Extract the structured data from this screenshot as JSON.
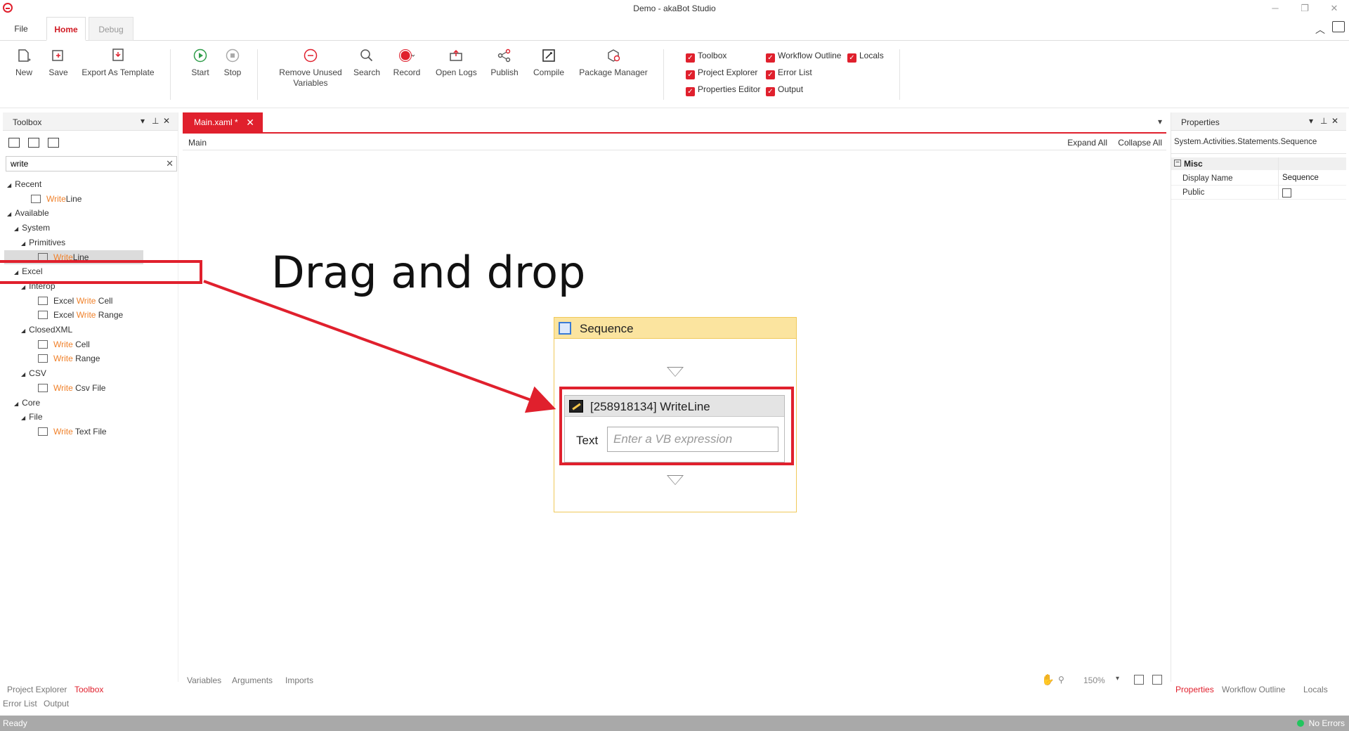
{
  "window": {
    "title": "Demo - akaBot Studio",
    "minimize": "─",
    "restore": "❐",
    "close": "✕"
  },
  "ribbon_tabs": [
    "File",
    "Home",
    "Debug"
  ],
  "ribbon": {
    "buttons": [
      {
        "label": "New",
        "icon": "new-file-icon"
      },
      {
        "label": "Save",
        "icon": "save-icon"
      },
      {
        "label": "Export As Template",
        "icon": "export-template-icon"
      },
      {
        "label": "Start",
        "icon": "play-icon"
      },
      {
        "label": "Stop",
        "icon": "stop-icon"
      },
      {
        "label": "Remove Unused\nVariables",
        "icon": "remove-icon"
      },
      {
        "label": "Search",
        "icon": "search-icon"
      },
      {
        "label": "Record",
        "icon": "record-icon"
      },
      {
        "label": "Open Logs",
        "icon": "open-logs-icon"
      },
      {
        "label": "Publish",
        "icon": "publish-icon"
      },
      {
        "label": "Compile",
        "icon": "compile-icon"
      },
      {
        "label": "Package Manager",
        "icon": "package-manager-icon"
      }
    ],
    "checkboxes": [
      {
        "label": "Toolbox",
        "checked": true
      },
      {
        "label": "Project Explorer",
        "checked": true
      },
      {
        "label": "Properties Editor",
        "checked": true
      },
      {
        "label": "Workflow Outline",
        "checked": true
      },
      {
        "label": "Error List",
        "checked": true
      },
      {
        "label": "Output",
        "checked": true
      },
      {
        "label": "Locals",
        "checked": true
      }
    ]
  },
  "toolbox": {
    "title": "Toolbox",
    "search_value": "write",
    "clear": "✕",
    "tree": [
      {
        "label": "Recent",
        "indent": 0,
        "type": "group"
      },
      {
        "hl": "Write",
        "rest": "Line",
        "indent": 2,
        "type": "activity"
      },
      {
        "label": "Available",
        "indent": 0,
        "type": "group"
      },
      {
        "label": "System",
        "indent": 1,
        "type": "group"
      },
      {
        "label": "Primitives",
        "indent": 2,
        "type": "group"
      },
      {
        "hl": "Write",
        "rest": "Line",
        "indent": 3,
        "type": "activity",
        "selected": true
      },
      {
        "label": "Excel",
        "indent": 1,
        "type": "group"
      },
      {
        "label": "Interop",
        "indent": 2,
        "type": "group"
      },
      {
        "pre": "Excel ",
        "hl": "Write",
        "rest": " Cell",
        "indent": 3,
        "type": "activity"
      },
      {
        "pre": "Excel ",
        "hl": "Write",
        "rest": " Range",
        "indent": 3,
        "type": "activity"
      },
      {
        "label": "ClosedXML",
        "indent": 2,
        "type": "group"
      },
      {
        "hl": "Write",
        "rest": " Cell",
        "indent": 3,
        "type": "activity"
      },
      {
        "hl": "Write",
        "rest": " Range",
        "indent": 3,
        "type": "activity"
      },
      {
        "label": "CSV",
        "indent": 2,
        "type": "group"
      },
      {
        "hl": "Write",
        "rest": " Csv File",
        "indent": 3,
        "type": "activity"
      },
      {
        "label": "Core",
        "indent": 1,
        "type": "group"
      },
      {
        "label": "File",
        "indent": 2,
        "type": "group"
      },
      {
        "hl": "Write",
        "rest": " Text File",
        "indent": 3,
        "type": "activity"
      }
    ],
    "bottom_tabs": [
      "Project Explorer",
      "Toolbox",
      "Error List",
      "Output"
    ]
  },
  "designer": {
    "tab_label": "Main.xaml *",
    "tab_close": "✕",
    "breadcrumb": "Main",
    "expand_all": "Expand All",
    "collapse_all": "Collapse All",
    "annotation": "Drag and drop",
    "sequence": {
      "title": "Sequence",
      "writeline": {
        "title": "[258918134] WriteLine",
        "text_label": "Text",
        "placeholder": "Enter a VB expression"
      }
    },
    "bottom_tabs": [
      "Variables",
      "Arguments",
      "Imports"
    ],
    "zoom": "150%"
  },
  "properties": {
    "title": "Properties",
    "type_name": "System.Activities.Statements.Sequence",
    "category": "Misc",
    "rows": [
      {
        "key": "Display Name",
        "value": "Sequence"
      },
      {
        "key": "Public",
        "value": ""
      }
    ],
    "bottom_tabs": [
      "Properties",
      "Workflow Outline",
      "Locals"
    ]
  },
  "status": {
    "left": "Ready",
    "right": "No Errors"
  },
  "colors": {
    "accent": "#e0202d",
    "highlight_text": "#f0812a",
    "sequence_header": "#fbe49f"
  }
}
